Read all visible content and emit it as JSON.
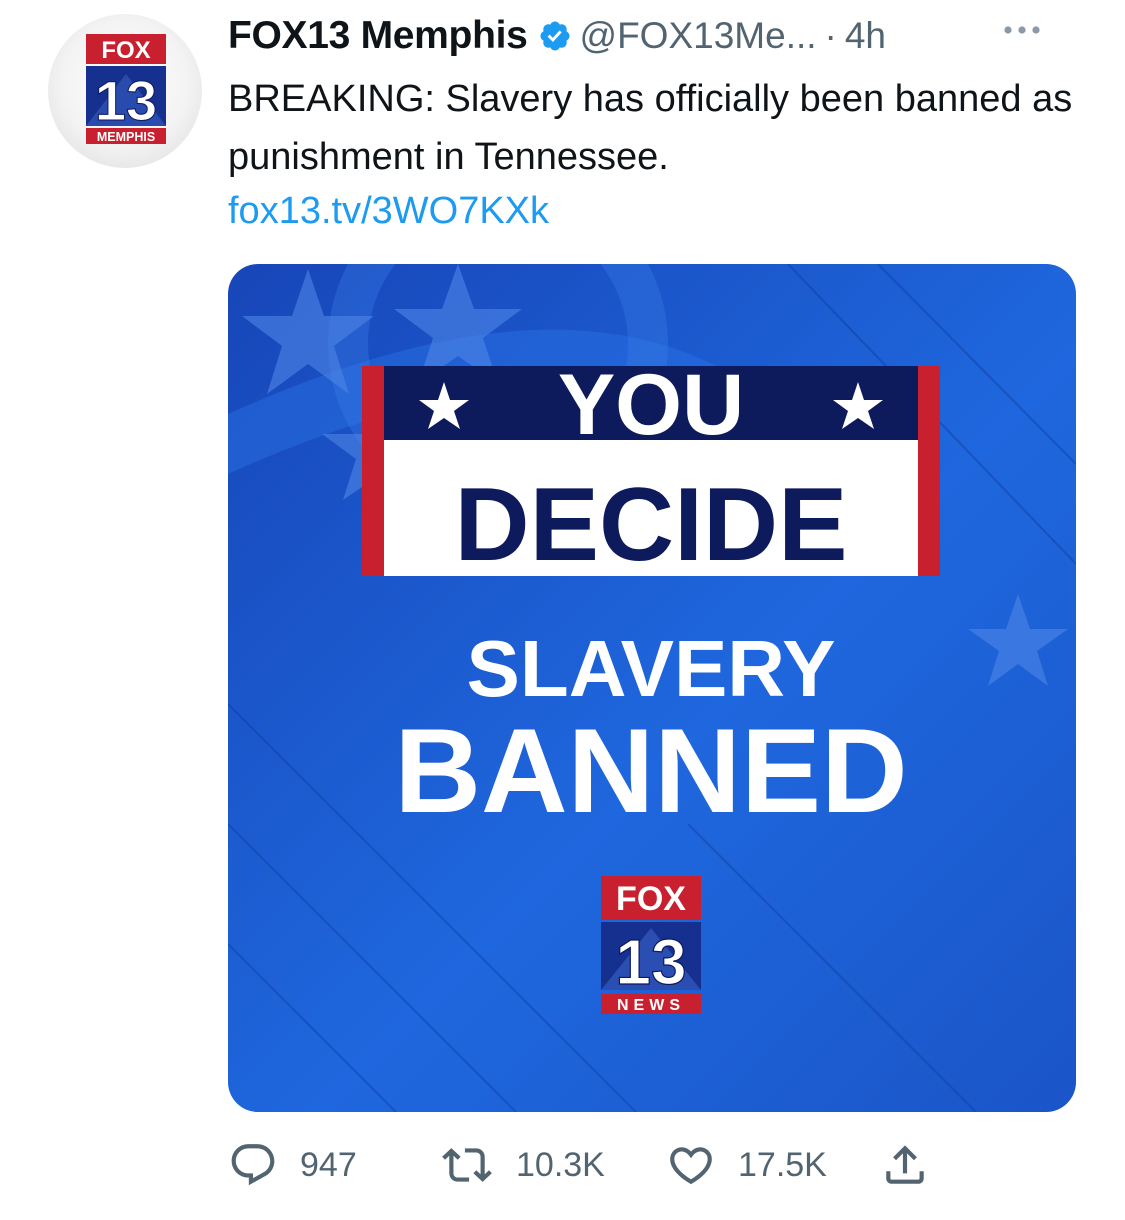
{
  "author": {
    "avatar": {
      "logo_text_fox": "FOX",
      "logo_text_number": "13",
      "logo_text_city": "MEMPHIS"
    },
    "display_name": "FOX13 Memphis",
    "verified_icon": "verified-badge-icon",
    "handle": "@FOX13Me...",
    "separator": "·",
    "time": "4h",
    "more_icon": "more-options-icon"
  },
  "tweet": {
    "text": "BREAKING: Slavery has officially been banned as punishment in Tennessee.",
    "link": "fox13.tv/3WO7KXk"
  },
  "media": {
    "banner_line1": "YOU",
    "banner_line2": "DECIDE",
    "headline_line1": "SLAVERY",
    "headline_line2": "BANNED",
    "logo_fox": "FOX",
    "logo_number": "13",
    "logo_news": "NEWS"
  },
  "actions": {
    "reply": {
      "icon": "reply-icon",
      "count": "947"
    },
    "retweet": {
      "icon": "retweet-icon",
      "count": "10.3K"
    },
    "like": {
      "icon": "heart-icon",
      "count": "17.5K"
    },
    "share": {
      "icon": "share-icon"
    }
  },
  "colors": {
    "link": "#1d9bf0",
    "verified": "#1d9bf0",
    "secondary_text": "#536471",
    "fox_red": "#c8202f",
    "navy": "#0d1a5c",
    "media_blue": "#1c5fd6"
  }
}
